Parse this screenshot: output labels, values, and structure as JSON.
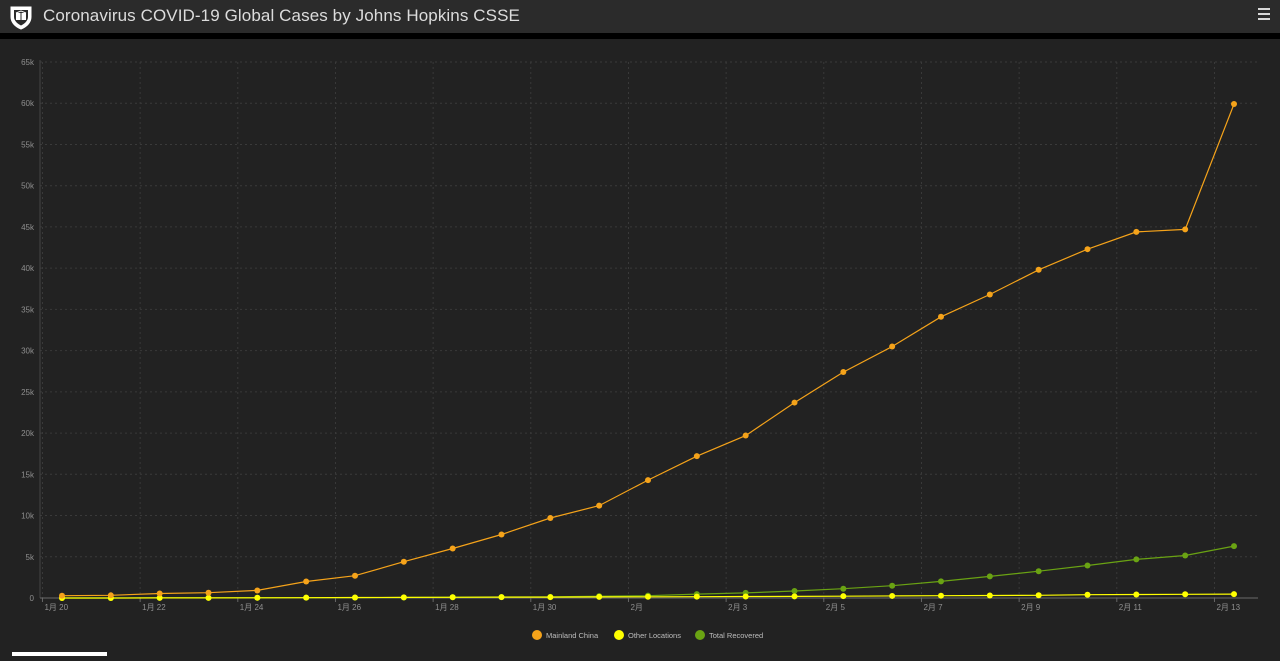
{
  "header": {
    "title": "Coronavirus COVID-19 Global Cases by Johns Hopkins CSSE",
    "logo_icon": "university-shield-icon",
    "menu_icon": "hamburger-menu-icon"
  },
  "colors": {
    "background": "#222222",
    "header": "#2b2b2b",
    "grid": "#3a3a3a",
    "tick_text": "#8f8f8f"
  },
  "chart_data": {
    "type": "line",
    "title": "",
    "xlabel": "",
    "ylabel": "",
    "x": [
      "1月 20",
      "1月 21",
      "1月 22",
      "1月 23",
      "1月 24",
      "1月 25",
      "1月 26",
      "1月 27",
      "1月 28",
      "1月 29",
      "1月 30",
      "1月 31",
      "2月 1",
      "2月 2",
      "2月 3",
      "2月 4",
      "2月 5",
      "2月 6",
      "2月 7",
      "2月 8",
      "2月 9",
      "2月 10",
      "2月 11",
      "2月 12",
      "2月 13"
    ],
    "x_tick_labels": [
      "1月 20",
      "1月 22",
      "1月 24",
      "1月 26",
      "1月 28",
      "1月 30",
      "2月",
      "2月 3",
      "2月 5",
      "2月 7",
      "2月 9",
      "2月 11",
      "2月 13"
    ],
    "x_tick_positions": [
      0,
      2,
      4,
      6,
      8,
      10,
      12,
      14,
      16,
      18,
      20,
      22,
      24
    ],
    "y_ticks": [
      0,
      5000,
      10000,
      15000,
      20000,
      25000,
      30000,
      35000,
      40000,
      45000,
      50000,
      55000,
      60000,
      65000
    ],
    "y_tick_labels": [
      "0",
      "5k",
      "10k",
      "15k",
      "20k",
      "25k",
      "30k",
      "35k",
      "40k",
      "45k",
      "50k",
      "55k",
      "60k",
      "65k"
    ],
    "ylim": [
      0,
      65000
    ],
    "grid": true,
    "legend_position": "bottom-center",
    "series": [
      {
        "name": "Mainland China",
        "color": "#f5a31a",
        "values": [
          278,
          326,
          547,
          639,
          916,
          2000,
          2700,
          4400,
          6000,
          7700,
          9700,
          11200,
          14300,
          17200,
          19700,
          23700,
          27400,
          30500,
          34100,
          36800,
          39800,
          42300,
          44400,
          44700,
          59900
        ]
      },
      {
        "name": "Other Locations",
        "color": "#ffff00",
        "values": [
          4,
          6,
          8,
          15,
          25,
          40,
          55,
          75,
          85,
          105,
          110,
          130,
          150,
          160,
          180,
          200,
          220,
          250,
          280,
          300,
          330,
          400,
          430,
          450,
          470
        ]
      },
      {
        "name": "Total Recovered",
        "color": "#6aa313",
        "values": [
          0,
          0,
          28,
          30,
          36,
          39,
          52,
          61,
          107,
          126,
          143,
          222,
          284,
          472,
          623,
          852,
          1124,
          1487,
          2011,
          2616,
          3244,
          3946,
          4683,
          5150,
          6295
        ]
      }
    ]
  }
}
